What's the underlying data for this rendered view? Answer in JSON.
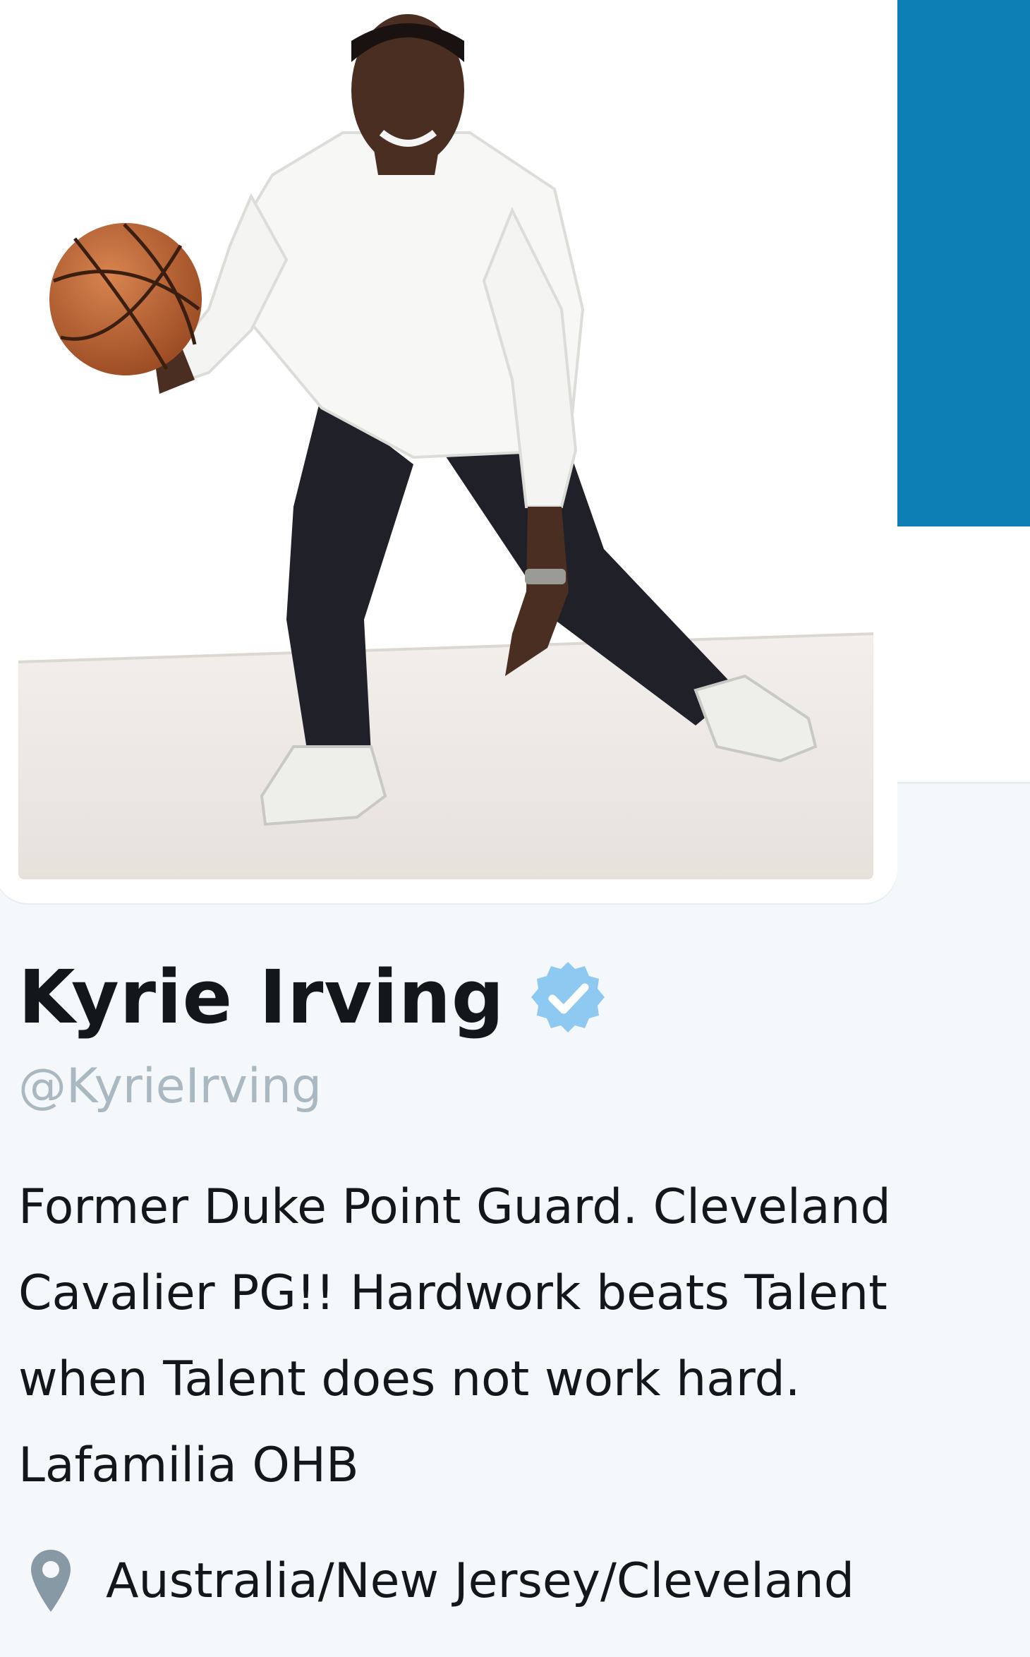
{
  "profile": {
    "name": "Kyrie Irving",
    "verified": true,
    "handle": "@KyrieIrving",
    "bio_lines": [
      "Former Duke Point Guard. Cleveland",
      "Cavalier PG!! Hardwork beats Talent",
      "when Talent does not work hard.",
      "Lafamilia OHB"
    ],
    "location": "Australia/New Jersey/Cleveland"
  },
  "icons": {
    "verified": "verified-badge-icon",
    "location": "location-pin-icon"
  },
  "colors": {
    "header_banner": "#0e7fb5",
    "verified": "#1da1f2",
    "name_text": "#14171a",
    "handle_text": "#aab8c2",
    "page_background": "#f5f8fa"
  }
}
